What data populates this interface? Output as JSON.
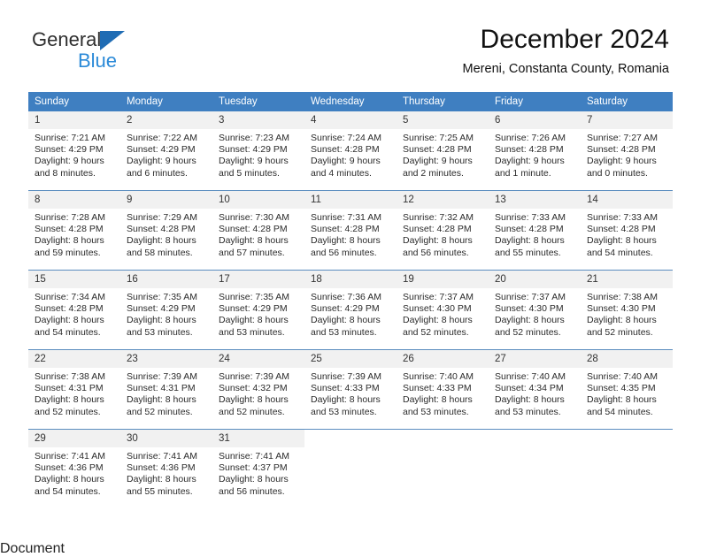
{
  "brand": {
    "line1": "General",
    "line2": "Blue",
    "triangle_color": "#1f6cb4",
    "blue_text_color": "#2b8ad8"
  },
  "header": {
    "title": "December 2024",
    "subtitle": "Mereni, Constanta County, Romania"
  },
  "theme": {
    "header_bg": "#3f7fc1",
    "header_text": "#ffffff",
    "daynum_bg": "#f1f1f1",
    "row_divider": "#5b8dbf",
    "cell_bg": "#ffffff",
    "body_text": "#2b2b2b"
  },
  "weekday_headers": [
    "Sunday",
    "Monday",
    "Tuesday",
    "Wednesday",
    "Thursday",
    "Friday",
    "Saturday"
  ],
  "weeks": [
    [
      {
        "day": "1",
        "sunrise": "Sunrise: 7:21 AM",
        "sunset": "Sunset: 4:29 PM",
        "daylight_line1": "Daylight: 9 hours",
        "daylight_line2": "and 8 minutes."
      },
      {
        "day": "2",
        "sunrise": "Sunrise: 7:22 AM",
        "sunset": "Sunset: 4:29 PM",
        "daylight_line1": "Daylight: 9 hours",
        "daylight_line2": "and 6 minutes."
      },
      {
        "day": "3",
        "sunrise": "Sunrise: 7:23 AM",
        "sunset": "Sunset: 4:29 PM",
        "daylight_line1": "Daylight: 9 hours",
        "daylight_line2": "and 5 minutes."
      },
      {
        "day": "4",
        "sunrise": "Sunrise: 7:24 AM",
        "sunset": "Sunset: 4:28 PM",
        "daylight_line1": "Daylight: 9 hours",
        "daylight_line2": "and 4 minutes."
      },
      {
        "day": "5",
        "sunrise": "Sunrise: 7:25 AM",
        "sunset": "Sunset: 4:28 PM",
        "daylight_line1": "Daylight: 9 hours",
        "daylight_line2": "and 2 minutes."
      },
      {
        "day": "6",
        "sunrise": "Sunrise: 7:26 AM",
        "sunset": "Sunset: 4:28 PM",
        "daylight_line1": "Daylight: 9 hours",
        "daylight_line2": "and 1 minute."
      },
      {
        "day": "7",
        "sunrise": "Sunrise: 7:27 AM",
        "sunset": "Sunset: 4:28 PM",
        "daylight_line1": "Daylight: 9 hours",
        "daylight_line2": "and 0 minutes."
      }
    ],
    [
      {
        "day": "8",
        "sunrise": "Sunrise: 7:28 AM",
        "sunset": "Sunset: 4:28 PM",
        "daylight_line1": "Daylight: 8 hours",
        "daylight_line2": "and 59 minutes."
      },
      {
        "day": "9",
        "sunrise": "Sunrise: 7:29 AM",
        "sunset": "Sunset: 4:28 PM",
        "daylight_line1": "Daylight: 8 hours",
        "daylight_line2": "and 58 minutes."
      },
      {
        "day": "10",
        "sunrise": "Sunrise: 7:30 AM",
        "sunset": "Sunset: 4:28 PM",
        "daylight_line1": "Daylight: 8 hours",
        "daylight_line2": "and 57 minutes."
      },
      {
        "day": "11",
        "sunrise": "Sunrise: 7:31 AM",
        "sunset": "Sunset: 4:28 PM",
        "daylight_line1": "Daylight: 8 hours",
        "daylight_line2": "and 56 minutes."
      },
      {
        "day": "12",
        "sunrise": "Sunrise: 7:32 AM",
        "sunset": "Sunset: 4:28 PM",
        "daylight_line1": "Daylight: 8 hours",
        "daylight_line2": "and 56 minutes."
      },
      {
        "day": "13",
        "sunrise": "Sunrise: 7:33 AM",
        "sunset": "Sunset: 4:28 PM",
        "daylight_line1": "Daylight: 8 hours",
        "daylight_line2": "and 55 minutes."
      },
      {
        "day": "14",
        "sunrise": "Sunrise: 7:33 AM",
        "sunset": "Sunset: 4:28 PM",
        "daylight_line1": "Daylight: 8 hours",
        "daylight_line2": "and 54 minutes."
      }
    ],
    [
      {
        "day": "15",
        "sunrise": "Sunrise: 7:34 AM",
        "sunset": "Sunset: 4:28 PM",
        "daylight_line1": "Daylight: 8 hours",
        "daylight_line2": "and 54 minutes."
      },
      {
        "day": "16",
        "sunrise": "Sunrise: 7:35 AM",
        "sunset": "Sunset: 4:29 PM",
        "daylight_line1": "Daylight: 8 hours",
        "daylight_line2": "and 53 minutes."
      },
      {
        "day": "17",
        "sunrise": "Sunrise: 7:35 AM",
        "sunset": "Sunset: 4:29 PM",
        "daylight_line1": "Daylight: 8 hours",
        "daylight_line2": "and 53 minutes."
      },
      {
        "day": "18",
        "sunrise": "Sunrise: 7:36 AM",
        "sunset": "Sunset: 4:29 PM",
        "daylight_line1": "Daylight: 8 hours",
        "daylight_line2": "and 53 minutes."
      },
      {
        "day": "19",
        "sunrise": "Sunrise: 7:37 AM",
        "sunset": "Sunset: 4:30 PM",
        "daylight_line1": "Daylight: 8 hours",
        "daylight_line2": "and 52 minutes."
      },
      {
        "day": "20",
        "sunrise": "Sunrise: 7:37 AM",
        "sunset": "Sunset: 4:30 PM",
        "daylight_line1": "Daylight: 8 hours",
        "daylight_line2": "and 52 minutes."
      },
      {
        "day": "21",
        "sunrise": "Sunrise: 7:38 AM",
        "sunset": "Sunset: 4:30 PM",
        "daylight_line1": "Daylight: 8 hours",
        "daylight_line2": "and 52 minutes."
      }
    ],
    [
      {
        "day": "22",
        "sunrise": "Sunrise: 7:38 AM",
        "sunset": "Sunset: 4:31 PM",
        "daylight_line1": "Daylight: 8 hours",
        "daylight_line2": "and 52 minutes."
      },
      {
        "day": "23",
        "sunrise": "Sunrise: 7:39 AM",
        "sunset": "Sunset: 4:31 PM",
        "daylight_line1": "Daylight: 8 hours",
        "daylight_line2": "and 52 minutes."
      },
      {
        "day": "24",
        "sunrise": "Sunrise: 7:39 AM",
        "sunset": "Sunset: 4:32 PM",
        "daylight_line1": "Daylight: 8 hours",
        "daylight_line2": "and 52 minutes."
      },
      {
        "day": "25",
        "sunrise": "Sunrise: 7:39 AM",
        "sunset": "Sunset: 4:33 PM",
        "daylight_line1": "Daylight: 8 hours",
        "daylight_line2": "and 53 minutes."
      },
      {
        "day": "26",
        "sunrise": "Sunrise: 7:40 AM",
        "sunset": "Sunset: 4:33 PM",
        "daylight_line1": "Daylight: 8 hours",
        "daylight_line2": "and 53 minutes."
      },
      {
        "day": "27",
        "sunrise": "Sunrise: 7:40 AM",
        "sunset": "Sunset: 4:34 PM",
        "daylight_line1": "Daylight: 8 hours",
        "daylight_line2": "and 53 minutes."
      },
      {
        "day": "28",
        "sunrise": "Sunrise: 7:40 AM",
        "sunset": "Sunset: 4:35 PM",
        "daylight_line1": "Daylight: 8 hours",
        "daylight_line2": "and 54 minutes."
      }
    ],
    [
      {
        "day": "29",
        "sunrise": "Sunrise: 7:41 AM",
        "sunset": "Sunset: 4:36 PM",
        "daylight_line1": "Daylight: 8 hours",
        "daylight_line2": "and 54 minutes."
      },
      {
        "day": "30",
        "sunrise": "Sunrise: 7:41 AM",
        "sunset": "Sunset: 4:36 PM",
        "daylight_line1": "Daylight: 8 hours",
        "daylight_line2": "and 55 minutes."
      },
      {
        "day": "31",
        "sunrise": "Sunrise: 7:41 AM",
        "sunset": "Sunset: 4:37 PM",
        "daylight_line1": "Daylight: 8 hours",
        "daylight_line2": "and 56 minutes."
      },
      {
        "day": "",
        "sunrise": "",
        "sunset": "",
        "daylight_line1": "",
        "daylight_line2": ""
      },
      {
        "day": "",
        "sunrise": "",
        "sunset": "",
        "daylight_line1": "",
        "daylight_line2": ""
      },
      {
        "day": "",
        "sunrise": "",
        "sunset": "",
        "daylight_line1": "",
        "daylight_line2": ""
      },
      {
        "day": "",
        "sunrise": "",
        "sunset": "",
        "daylight_line1": "",
        "daylight_line2": ""
      }
    ]
  ]
}
